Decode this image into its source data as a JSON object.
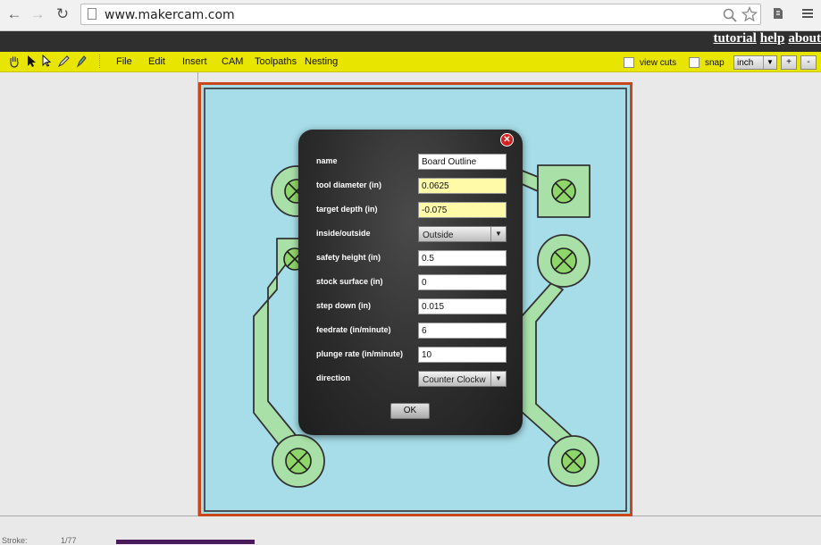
{
  "browser": {
    "url": "www.makercam.com",
    "back_icon": "←",
    "forward_icon": "→",
    "reload_icon": "↻"
  },
  "topnav": {
    "links": [
      "tutorial",
      "help",
      "about"
    ]
  },
  "toolbar": {
    "menus": [
      "File",
      "Edit",
      "Insert",
      "CAM",
      "Toolpaths",
      "Nesting"
    ],
    "view_cuts_label": "view cuts",
    "snap_label": "snap",
    "unit_value": "inch",
    "zoom_in": "+",
    "zoom_out": "-"
  },
  "dialog": {
    "fields": [
      {
        "label": "name",
        "value": "Board Outline",
        "type": "text"
      },
      {
        "label": "tool diameter (in)",
        "value": "0.0625",
        "type": "text-highlight"
      },
      {
        "label": "target depth (in)",
        "value": "-0.075",
        "type": "text-highlight"
      },
      {
        "label": "inside/outside",
        "value": "Outside",
        "type": "select"
      },
      {
        "label": "safety height (in)",
        "value": "0.5",
        "type": "text"
      },
      {
        "label": "stock surface (in)",
        "value": "0",
        "type": "text"
      },
      {
        "label": "step down (in)",
        "value": "0.015",
        "type": "text"
      },
      {
        "label": "feedrate (in/minute)",
        "value": "6",
        "type": "text"
      },
      {
        "label": "plunge rate (in/minute)",
        "value": "10",
        "type": "text"
      },
      {
        "label": "direction",
        "value": "Counter Clockw",
        "type": "select"
      }
    ],
    "ok_label": "OK"
  },
  "status": {
    "stroke_label": "Stroke:",
    "stroke_value": "1/77"
  },
  "colors": {
    "canvas_bg": "#a6dde8",
    "board_border": "#c9471b",
    "pad_fill": "#a8e0a8",
    "toolbar_yellow": "#e8e500"
  }
}
